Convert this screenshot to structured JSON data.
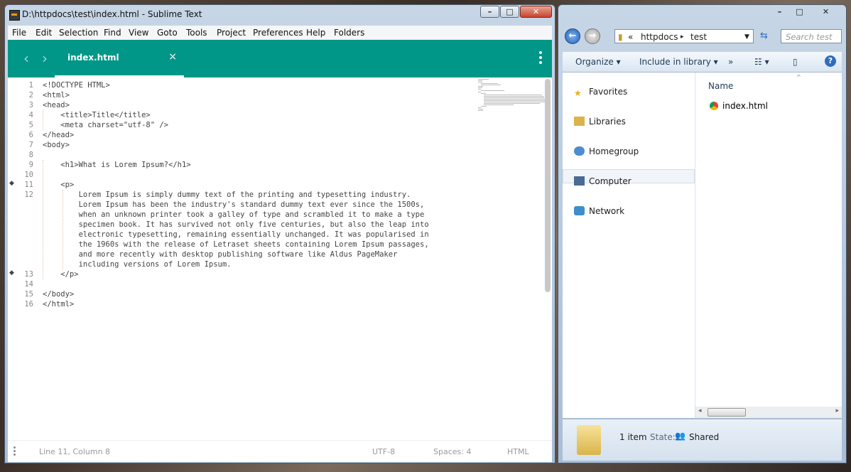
{
  "sublime": {
    "title": "D:\\httpdocs\\test\\index.html - Sublime Text",
    "menu": [
      "File",
      "Edit",
      "Selection",
      "Find",
      "View",
      "Goto",
      "Tools",
      "Project",
      "Preferences",
      "Help",
      "Folders"
    ],
    "tab": {
      "label": "index.html",
      "close": "×"
    },
    "lines": [
      {
        "n": "1",
        "t": "<!DOCTYPE HTML>"
      },
      {
        "n": "2",
        "t": "<html>"
      },
      {
        "n": "3",
        "t": "<head>"
      },
      {
        "n": "4",
        "t": "    <title>Title</title>"
      },
      {
        "n": "5",
        "t": "    <meta charset=\"utf-8\" />"
      },
      {
        "n": "6",
        "t": "</head>"
      },
      {
        "n": "7",
        "t": "<body>"
      },
      {
        "n": "8",
        "t": ""
      },
      {
        "n": "9",
        "t": "    <h1>What is Lorem Ipsum?</h1>"
      },
      {
        "n": "10",
        "t": ""
      },
      {
        "n": "11",
        "t": "    <p>"
      },
      {
        "n": "12",
        "t": "        Lorem Ipsum is simply dummy text of the printing and typesetting industry."
      },
      {
        "n": "",
        "t": "        Lorem Ipsum has been the industry's standard dummy text ever since the 1500s,"
      },
      {
        "n": "",
        "t": "        when an unknown printer took a galley of type and scrambled it to make a type"
      },
      {
        "n": "",
        "t": "        specimen book. It has survived not only five centuries, but also the leap into"
      },
      {
        "n": "",
        "t": "        electronic typesetting, remaining essentially unchanged. It was popularised in"
      },
      {
        "n": "",
        "t": "        the 1960s with the release of Letraset sheets containing Lorem Ipsum passages,"
      },
      {
        "n": "",
        "t": "        and more recently with desktop publishing software like Aldus PageMaker"
      },
      {
        "n": "",
        "t": "        including versions of Lorem Ipsum."
      },
      {
        "n": "13",
        "t": "    </p>"
      },
      {
        "n": "14",
        "t": ""
      },
      {
        "n": "15",
        "t": "</body>"
      },
      {
        "n": "16",
        "t": "</html>"
      }
    ],
    "status": {
      "position": "Line 11, Column 8",
      "encoding": "UTF-8",
      "indent": "Spaces: 4",
      "syntax": "HTML"
    }
  },
  "explorer": {
    "breadcrumb": [
      "«",
      "httpdocs",
      "▸",
      "test"
    ],
    "search_placeholder": "Search test",
    "toolbar": {
      "organize": "Organize",
      "include": "Include in library",
      "more": "»"
    },
    "nav": [
      "Favorites",
      "Libraries",
      "Homegroup",
      "Computer",
      "Network"
    ],
    "column": "Name",
    "files": [
      "index.html"
    ],
    "details": {
      "count": "1 item",
      "state_label": "State:",
      "state": "Shared"
    }
  },
  "colors": {
    "accent": "#009688",
    "explorer_accent": "#2f6cc0"
  }
}
